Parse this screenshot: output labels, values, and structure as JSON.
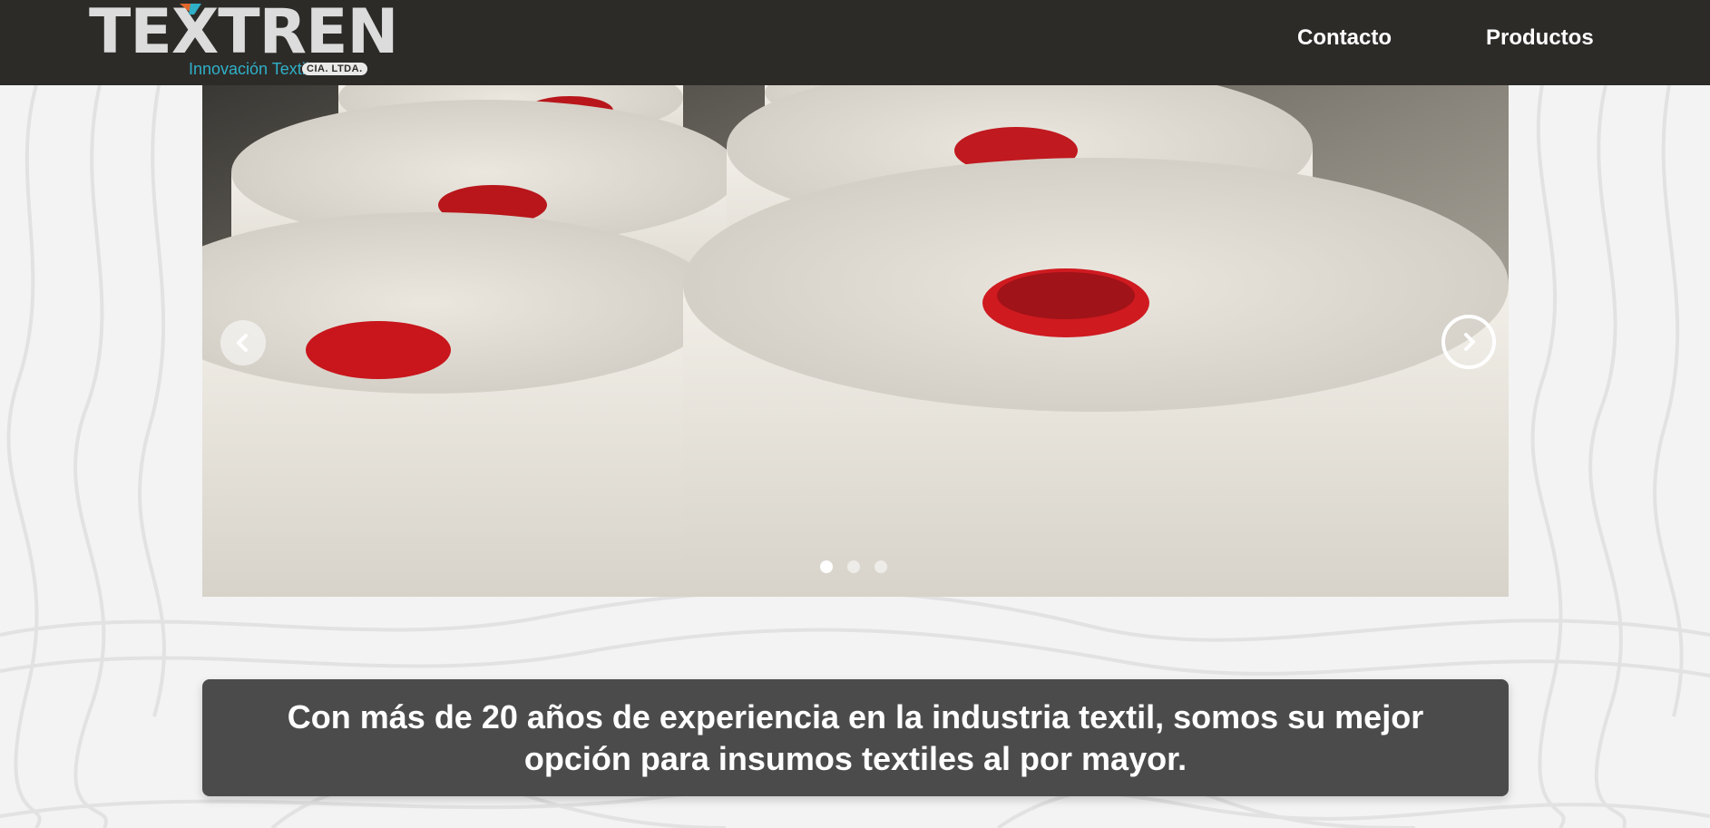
{
  "header": {
    "logo": {
      "wordmark": "TEXTREN",
      "tagline": "Innovación Textil",
      "badge": "CIA. LTDA."
    },
    "nav": [
      {
        "label": "Contacto"
      },
      {
        "label": "Productos"
      }
    ]
  },
  "carousel": {
    "prev_icon": "chevron-left-icon",
    "next_icon": "chevron-right-icon",
    "slide_count": 3,
    "active_slide": 1
  },
  "intro": {
    "text": "Con más de 20 años de experiencia en la industria textil, somos su mejor opción para insumos textiles al por mayor."
  },
  "colors": {
    "header_bg": "#2d2b28",
    "accent_teal": "#2fb0c8",
    "accent_orange": "#e2672a",
    "caption_bg": "#4b4b4b",
    "page_bg": "#f3f3f3"
  }
}
